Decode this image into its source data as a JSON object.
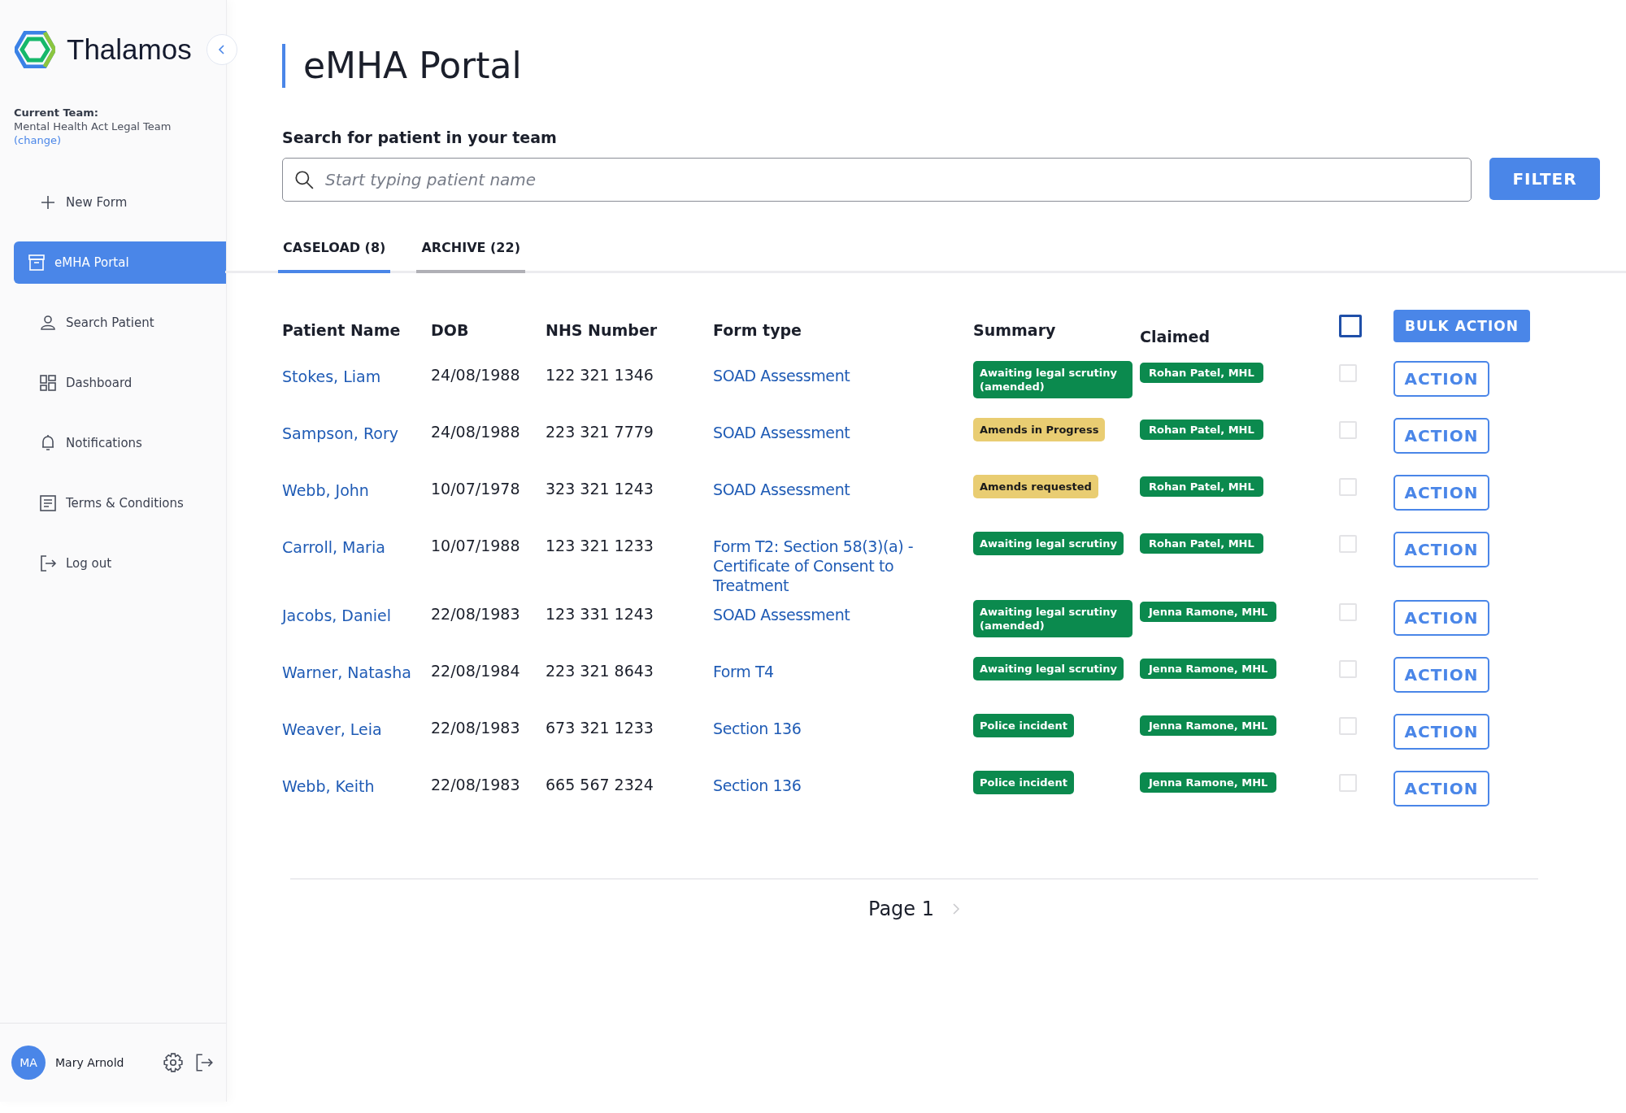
{
  "sidebar": {
    "brand": "Thalamos",
    "team_label": "Current Team:",
    "team_name": "Mental Health Act Legal Team",
    "change_link": "(change)",
    "items": [
      {
        "label": "New Form",
        "kind": "plus",
        "selected": false
      },
      {
        "label": "eMHA Portal",
        "kind": "archive",
        "selected": true
      },
      {
        "label": "Search Patient",
        "kind": "person",
        "selected": false
      },
      {
        "label": "Dashboard",
        "kind": "grid",
        "selected": false
      },
      {
        "label": "Notifications",
        "kind": "bell",
        "selected": false
      },
      {
        "label": "Terms & Conditions",
        "kind": "doc",
        "selected": false
      },
      {
        "label": "Log out",
        "kind": "logout",
        "selected": false
      }
    ],
    "user": {
      "initials": "MA",
      "name": "Mary Arnold"
    }
  },
  "page": {
    "title": "eMHA Portal",
    "search_label": "Search for patient in your team",
    "search": {
      "placeholder": "Start typing patient name"
    },
    "filter_button": "FILTER"
  },
  "tabs": [
    {
      "label": "CASELOAD (8)",
      "selected": true
    },
    {
      "label": "ARCHIVE (22)",
      "selected": false
    }
  ],
  "table": {
    "columns": [
      "Patient Name",
      "DOB",
      "NHS Number",
      "Form type",
      "Summary",
      "Claimed"
    ],
    "select_all": {
      "checked": false
    },
    "bulk_button": "BULK ACTION",
    "rows": [
      {
        "name": "Stokes, Liam",
        "dob": "24/08/1988",
        "nhs": "122 321 1346",
        "form": "SOAD Assessment",
        "summary": {
          "text": "Awaiting legal scrutiny (amended)",
          "color": "#0b8a4e"
        },
        "claimed": "Rohan Patel, MHL",
        "checked": false,
        "action": "ACTION"
      },
      {
        "name": "Sampson, Rory",
        "dob": "24/08/1988",
        "nhs": "223 321 7779",
        "form": "SOAD Assessment",
        "summary": {
          "text": "Amends in Progress",
          "color": "#e9cd72"
        },
        "claimed": "Rohan Patel, MHL",
        "checked": false,
        "action": "ACTION"
      },
      {
        "name": "Webb, John",
        "dob": "10/07/1978",
        "nhs": "323 321 1243",
        "form": "SOAD Assessment",
        "summary": {
          "text": "Amends requested",
          "color": "#e9cd72"
        },
        "claimed": "Rohan Patel, MHL",
        "checked": false,
        "action": "ACTION"
      },
      {
        "name": "Carroll, Maria",
        "dob": "10/07/1988",
        "nhs": "123 321 1233",
        "form": "Form T2: Section 58(3)(a) - Certificate of Consent to Treatment",
        "summary": {
          "text": "Awaiting legal scrutiny",
          "color": "#0b8a4e"
        },
        "claimed": "Rohan Patel, MHL",
        "checked": false,
        "action": "ACTION"
      },
      {
        "name": "Jacobs, Daniel",
        "dob": "22/08/1983",
        "nhs": "123 331 1243",
        "form": "SOAD Assessment",
        "summary": {
          "text": "Awaiting legal scrutiny (amended)",
          "color": "#0b8a4e"
        },
        "claimed": "Jenna Ramone, MHL",
        "checked": false,
        "action": "ACTION"
      },
      {
        "name": "Warner, Natasha",
        "dob": "22/08/1984",
        "nhs": "223 321 8643",
        "form": "Form T4",
        "summary": {
          "text": "Awaiting legal scrutiny",
          "color": "#0b8a4e"
        },
        "claimed": "Jenna Ramone, MHL",
        "checked": false,
        "action": "ACTION"
      },
      {
        "name": "Weaver, Leia",
        "dob": "22/08/1983",
        "nhs": "673 321 1233",
        "form": "Section 136",
        "summary": {
          "text": "Police incident",
          "color": "#0b8a4e"
        },
        "claimed": "Jenna Ramone, MHL",
        "checked": false,
        "action": "ACTION"
      },
      {
        "name": "Webb, Keith",
        "dob": "22/08/1983",
        "nhs": "665 567 2324",
        "form": "Section 136",
        "summary": {
          "text": "Police incident",
          "color": "#0b8a4e"
        },
        "claimed": "Jenna Ramone, MHL",
        "checked": false,
        "action": "ACTION"
      }
    ]
  },
  "pagination": {
    "label": "Page 1"
  }
}
